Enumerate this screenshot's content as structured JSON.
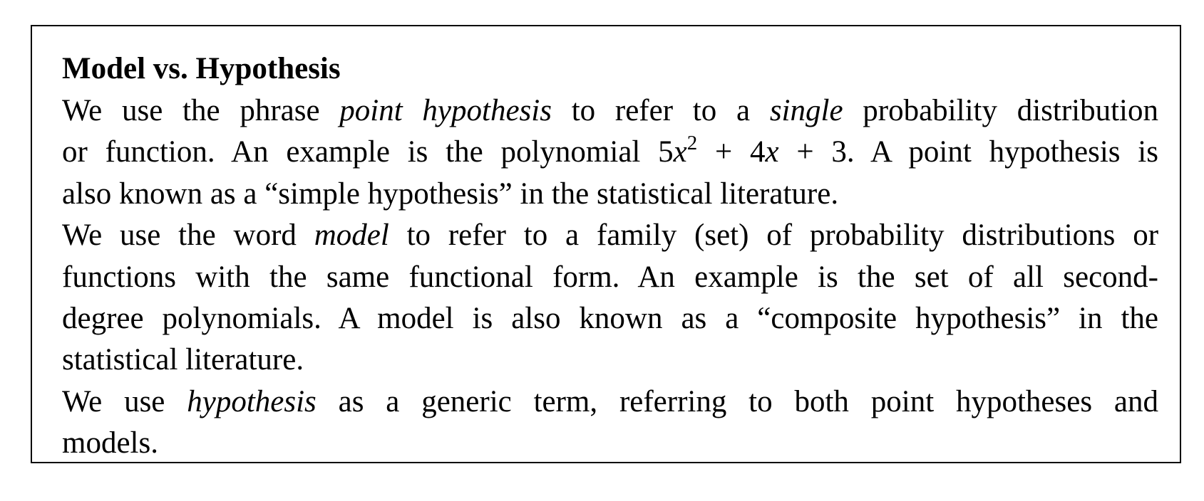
{
  "title": "Model vs. Hypothesis",
  "lines": [
    {
      "justify": true,
      "segments": [
        {
          "t": "We use the phrase "
        },
        {
          "t": "point hypothesis",
          "s": "i"
        },
        {
          "t": " to refer to a "
        },
        {
          "t": "single",
          "s": "i"
        },
        {
          "t": " probability distribution"
        }
      ]
    },
    {
      "justify": true,
      "segments": [
        {
          "t": "or function. An example is the polynomial 5"
        },
        {
          "t": "x",
          "s": "i"
        },
        {
          "t": "2",
          "s": "sup"
        },
        {
          "t": " + 4"
        },
        {
          "t": "x",
          "s": "i"
        },
        {
          "t": " + 3. A point hypothesis is"
        }
      ]
    },
    {
      "justify": false,
      "segments": [
        {
          "t": "also known as a “simple hypothesis” in the statistical literature."
        }
      ]
    },
    {
      "justify": true,
      "segments": [
        {
          "t": "We use the word "
        },
        {
          "t": "model",
          "s": "i"
        },
        {
          "t": " to refer to a family (set) of probability distributions or"
        }
      ]
    },
    {
      "justify": true,
      "segments": [
        {
          "t": "functions with the same functional form. An example is the set of all second-"
        }
      ]
    },
    {
      "justify": true,
      "segments": [
        {
          "t": "degree polynomials. A model is also known as a “composite hypothesis” in the"
        }
      ]
    },
    {
      "justify": false,
      "segments": [
        {
          "t": "statistical literature."
        }
      ]
    },
    {
      "justify": true,
      "segments": [
        {
          "t": "We use "
        },
        {
          "t": "hypothesis",
          "s": "i"
        },
        {
          "t": " as a generic term, referring to both point hypotheses and"
        }
      ]
    },
    {
      "justify": false,
      "segments": [
        {
          "t": "models."
        }
      ]
    }
  ]
}
